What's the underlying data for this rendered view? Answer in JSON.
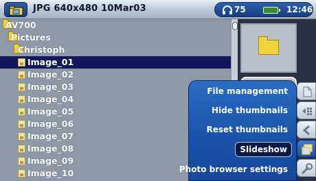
{
  "header": {
    "title": "JPG 640x480 10Mar03",
    "volume": "75",
    "time": "12:46"
  },
  "tree": [
    {
      "label": "AV700",
      "type": "folder",
      "depth": 0
    },
    {
      "label": "Pictures",
      "type": "folder",
      "depth": 1
    },
    {
      "label": "Christoph",
      "type": "folder",
      "depth": 2
    },
    {
      "label": "Image_01",
      "type": "image",
      "depth": 3,
      "selected": true
    },
    {
      "label": "Image_02",
      "type": "image",
      "depth": 3
    },
    {
      "label": "Image_03",
      "type": "image",
      "depth": 3
    },
    {
      "label": "Image_04",
      "type": "image",
      "depth": 3
    },
    {
      "label": "Image_05",
      "type": "image",
      "depth": 3
    },
    {
      "label": "Image_06",
      "type": "image",
      "depth": 3
    },
    {
      "label": "Image_07",
      "type": "image",
      "depth": 3
    },
    {
      "label": "Image_08",
      "type": "image",
      "depth": 3
    },
    {
      "label": "Image_09",
      "type": "image",
      "depth": 3
    },
    {
      "label": "Image_10",
      "type": "image",
      "depth": 3
    }
  ],
  "menu": {
    "items": [
      {
        "label": "File management",
        "selected": false
      },
      {
        "label": "Hide thumbnails",
        "selected": false
      },
      {
        "label": "Reset thumbnails",
        "selected": false
      },
      {
        "label": "Slideshow",
        "selected": true
      },
      {
        "label": "Photo browser settings",
        "selected": false
      }
    ]
  },
  "side_icons": [
    "file-icon",
    "thumbnail-toggle-icon",
    "reset-icon",
    "slideshow-icon",
    "settings-wrench-icon"
  ],
  "colors": {
    "accent": "#1852a8",
    "selection": "#11185a",
    "folder": "#f0d43b"
  }
}
